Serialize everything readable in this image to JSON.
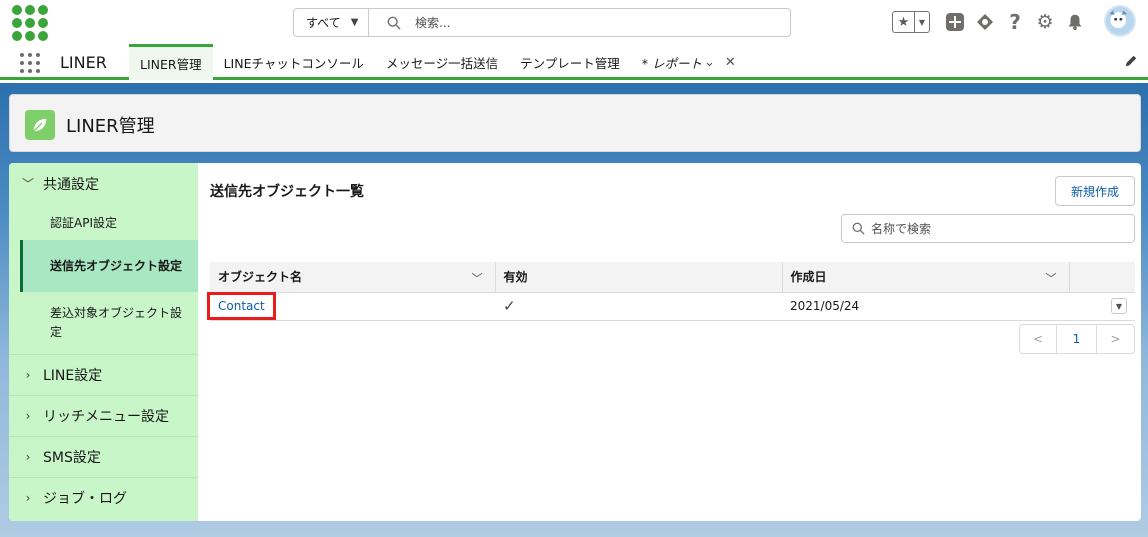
{
  "header": {
    "search_scope": "すべて",
    "search_placeholder": "検索..."
  },
  "app_nav": {
    "app_name": "LINER",
    "tabs": [
      {
        "label": "LINER管理",
        "active": true
      },
      {
        "label": "LINEチャットコンソール"
      },
      {
        "label": "メッセージ一括送信"
      },
      {
        "label": "テンプレート管理"
      },
      {
        "label": "* レポート"
      }
    ]
  },
  "page_header": {
    "title": "LINER管理"
  },
  "sidebar": {
    "sections": [
      {
        "label": "共通設定",
        "expanded": true,
        "items": [
          "認証API設定",
          "送信先オブジェクト設定",
          "差込対象オブジェクト設定"
        ]
      },
      {
        "label": "LINE設定"
      },
      {
        "label": "リッチメニュー設定"
      },
      {
        "label": "SMS設定"
      },
      {
        "label": "ジョブ・ログ"
      }
    ]
  },
  "list": {
    "title": "送信先オブジェクト一覧",
    "new_button": "新規作成",
    "search_placeholder": "名称で検索",
    "columns": [
      "オブジェクト名",
      "有効",
      "作成日"
    ],
    "rows": [
      {
        "name": "Contact",
        "active_mark": "✓",
        "created": "2021/05/24"
      }
    ]
  },
  "pager": {
    "prev": "<",
    "current": "1",
    "next": ">"
  },
  "colors": {
    "brand_green": "#3aa53a",
    "sidebar_bg": "#c9f6c9",
    "link_blue": "#0b5cab",
    "highlight_red": "#e81c1c"
  }
}
